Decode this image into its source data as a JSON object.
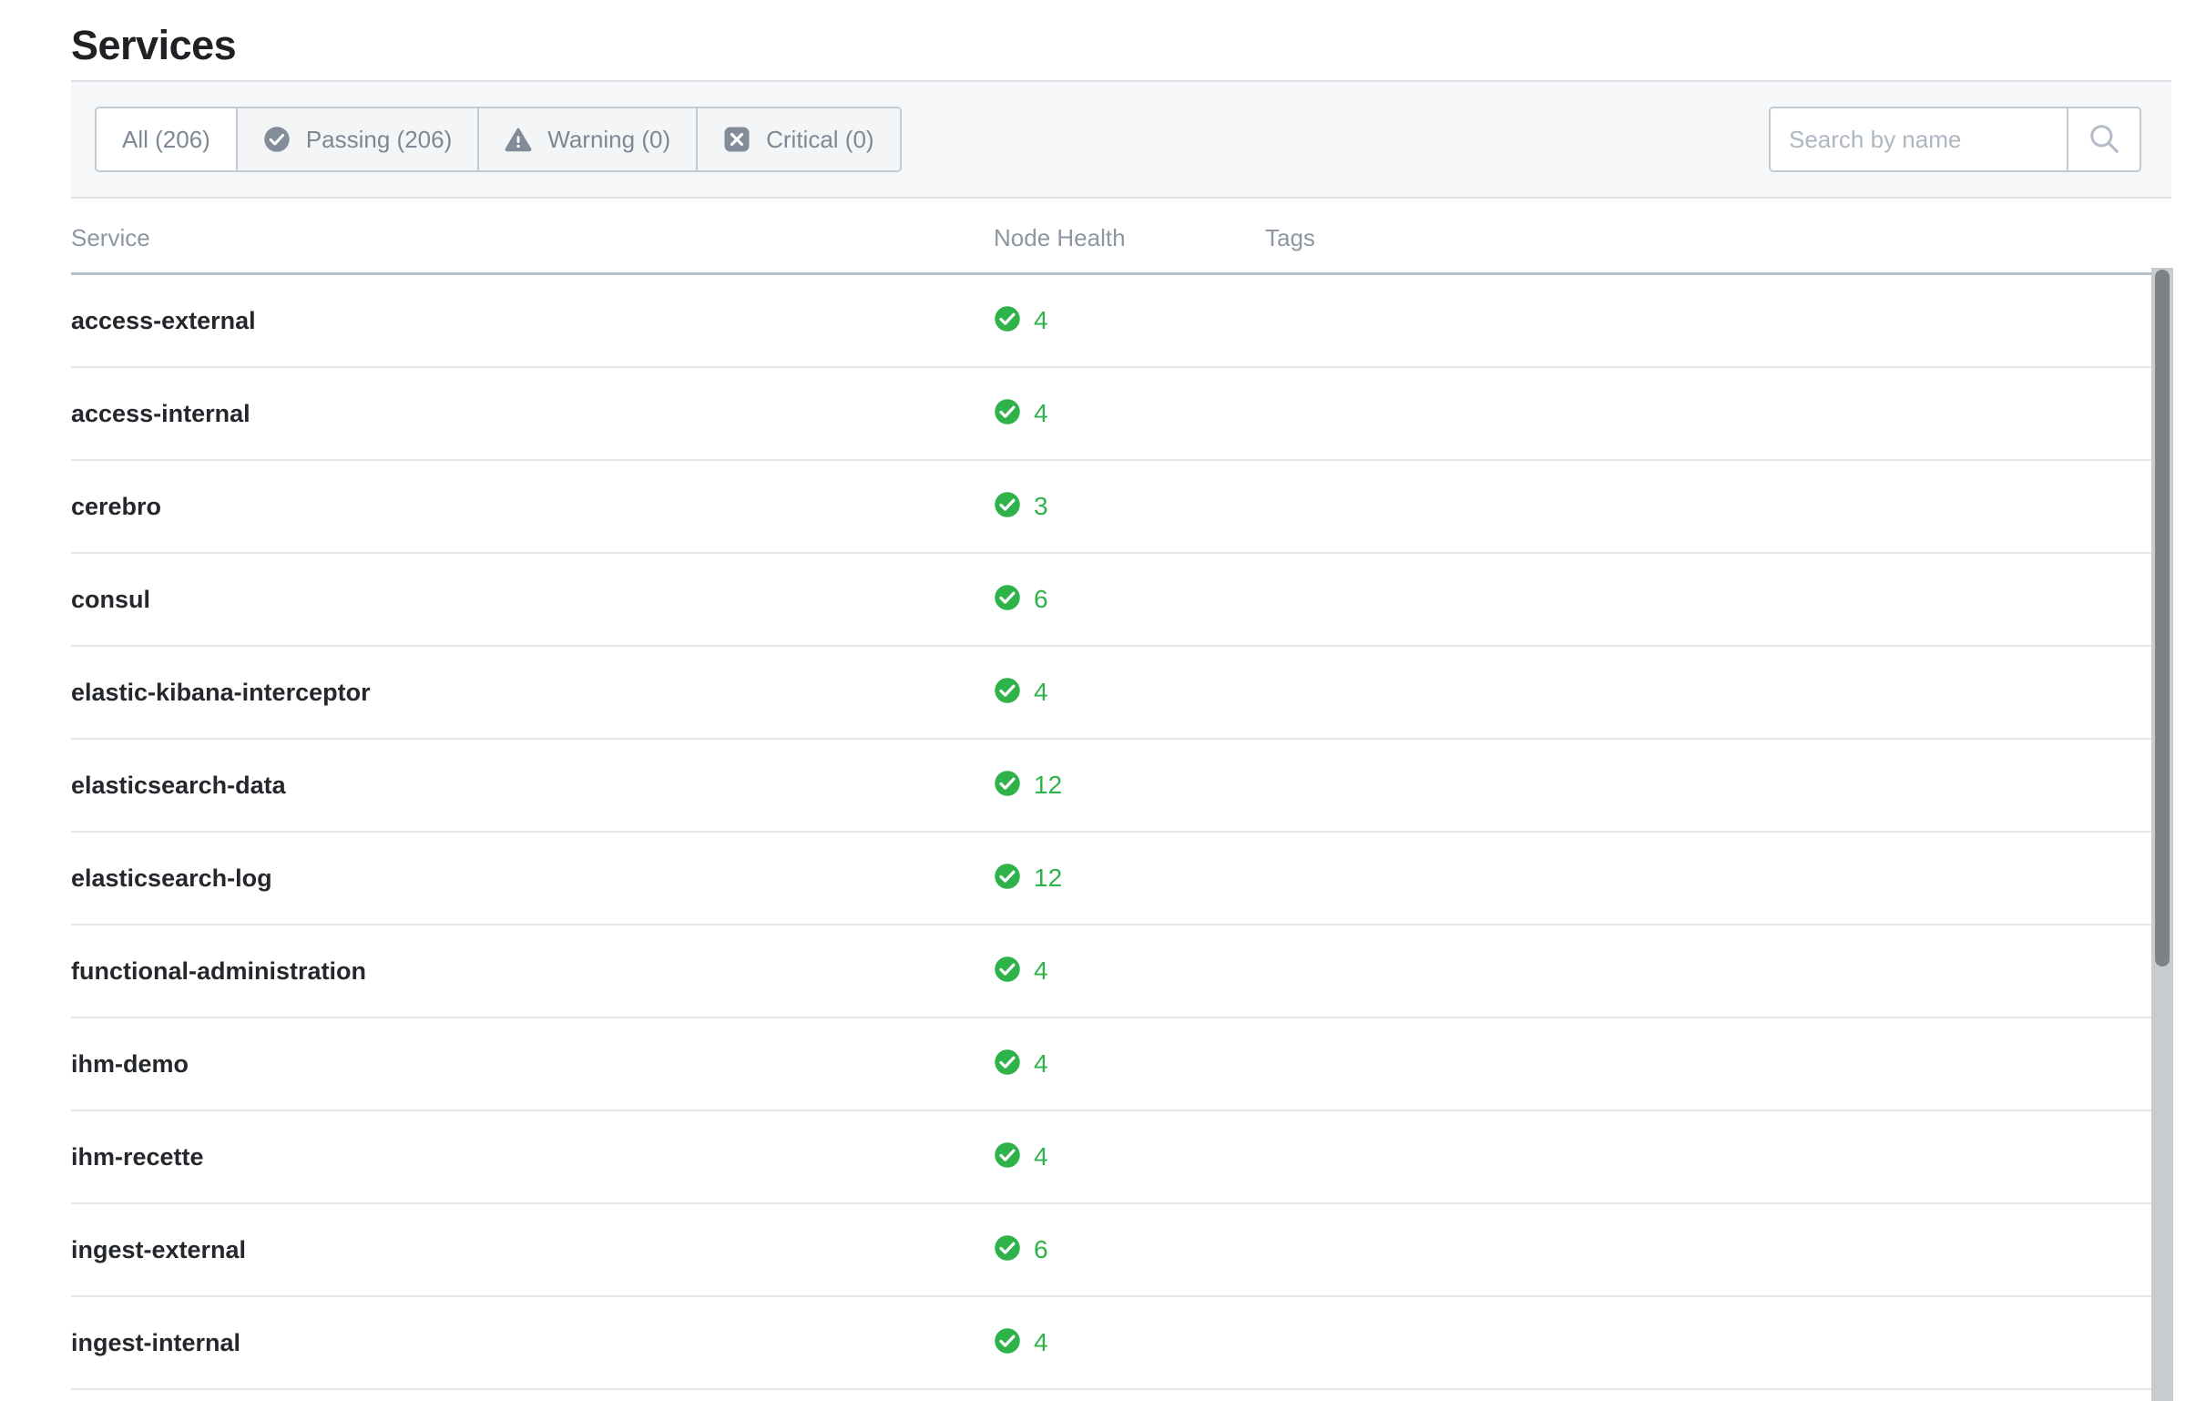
{
  "page": {
    "title": "Services"
  },
  "filters": {
    "tabs": [
      {
        "label": "All (206)",
        "icon": null,
        "active": true
      },
      {
        "label": "Passing (206)",
        "icon": "check-circle-icon",
        "active": false
      },
      {
        "label": "Warning (0)",
        "icon": "alert-triangle-icon",
        "active": false
      },
      {
        "label": "Critical (0)",
        "icon": "x-square-icon",
        "active": false
      }
    ]
  },
  "search": {
    "value": "",
    "placeholder": "Search by name",
    "button_icon": "search-icon"
  },
  "table": {
    "columns": [
      "Service",
      "Node Health",
      "Tags"
    ],
    "rows": [
      {
        "service": "access-external",
        "health_status": "passing",
        "health_count": "4",
        "tags": ""
      },
      {
        "service": "access-internal",
        "health_status": "passing",
        "health_count": "4",
        "tags": ""
      },
      {
        "service": "cerebro",
        "health_status": "passing",
        "health_count": "3",
        "tags": ""
      },
      {
        "service": "consul",
        "health_status": "passing",
        "health_count": "6",
        "tags": ""
      },
      {
        "service": "elastic-kibana-interceptor",
        "health_status": "passing",
        "health_count": "4",
        "tags": ""
      },
      {
        "service": "elasticsearch-data",
        "health_status": "passing",
        "health_count": "12",
        "tags": ""
      },
      {
        "service": "elasticsearch-log",
        "health_status": "passing",
        "health_count": "12",
        "tags": ""
      },
      {
        "service": "functional-administration",
        "health_status": "passing",
        "health_count": "4",
        "tags": ""
      },
      {
        "service": "ihm-demo",
        "health_status": "passing",
        "health_count": "4",
        "tags": ""
      },
      {
        "service": "ihm-recette",
        "health_status": "passing",
        "health_count": "4",
        "tags": ""
      },
      {
        "service": "ingest-external",
        "health_status": "passing",
        "health_count": "6",
        "tags": ""
      },
      {
        "service": "ingest-internal",
        "health_status": "passing",
        "health_count": "4",
        "tags": ""
      }
    ]
  },
  "colors": {
    "passing_green": "#2eb24a",
    "filter_bar_bg": "#f6f7f8",
    "muted_text": "#8d96a1",
    "title_text": "#1f2124",
    "scrollbar_thumb": "#7d8286"
  }
}
